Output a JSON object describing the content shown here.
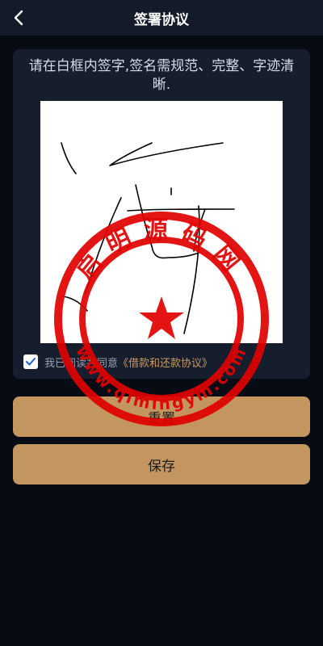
{
  "header": {
    "title": "签署协议",
    "back_icon": "back-arrow-icon"
  },
  "card": {
    "instruction": "请在白框内签字,签名需规范、完整、字迹清晰.",
    "agreement": {
      "checked": true,
      "prefix": "我已阅读并同意",
      "link": "《借款和还款协议》"
    }
  },
  "buttons": {
    "reset": "重置",
    "save": "保存"
  },
  "watermark": {
    "top_text": "启明源码网",
    "bottom_text": "www.qimingym.com",
    "color": "#e00000"
  },
  "colors": {
    "background": "#070b14",
    "card": "#161d2c",
    "button": "#c4965f",
    "link": "#c99a5f"
  }
}
